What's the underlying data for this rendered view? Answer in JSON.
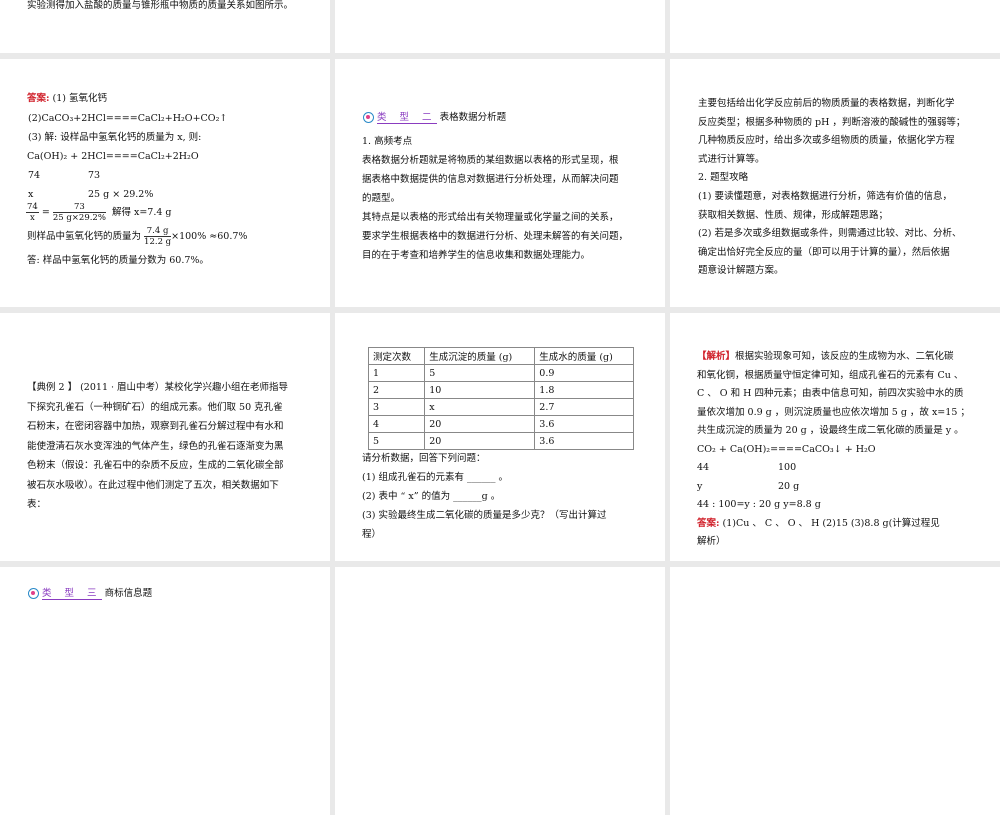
{
  "slide_top_left": {
    "text": "实验测得加入盐酸的质量与锥形瓶中物质的质量关系如图所示。"
  },
  "slide_answer1": {
    "label": "答案:",
    "l1": "(1) 氢氧化钙",
    "l2": "(2)CaCO₃+2HCl====CaCl₂+H₂O+CO₂↑",
    "l3": "(3) 解: 设样品中氢氧化钙的质量为 x, 则:",
    "l4": "Ca(OH)₂  +   2HCl====CaCl₂+2H₂O",
    "l5a": "74",
    "l5b": "73",
    "l6a": "x",
    "l6b": "25 g × 29.2%",
    "f1n": "74",
    "f1d": "x",
    "f2n": "73",
    "f2d": "25 g×29.2%",
    "solve": "解得 x=7.4 g",
    "l8": "则样品中氢氧化钙的质量为",
    "f3n": "7.4 g",
    "f3d": "12.2 g",
    "l8b": "×100% ≈60.7%",
    "l9": "答: 样品中氢氧化钙的质量分数为 60.7%。"
  },
  "slide_type2": {
    "badge": "类 型 二",
    "title": "表格数据分析题",
    "lines": [
      "1. 高频考点",
      "表格数据分析题就是将物质的某组数据以表格的形式呈现，根",
      "据表格中数据提供的信息对数据进行分析处理，从而解决问题",
      "的题型。",
      "其特点是以表格的形式给出有关物理量或化学量之间的关系，",
      "要求学生根据表格中的数据进行分析、处理未解答的有关问题，",
      "目的在于考查和培养学生的信息收集和数据处理能力。"
    ]
  },
  "slide_type2_cont": {
    "lines": [
      "主要包括给出化学反应前后的物质质量的表格数据，判断化学",
      "反应类型；根据多种物质的 pH ，判断溶液的酸碱性的强弱等；",
      "几种物质反应时，给出多次或多组物质的质量，依据化学方程",
      "式进行计算等。",
      "2. 题型攻略",
      "(1) 要读懂题意，对表格数据进行分析，筛选有价值的信息，",
      "获取相关数据、性质、规律，形成解题思路；",
      "(2) 若是多次或多组数据或条件，则需通过比较、对比、分析、",
      "确定出恰好完全反应的量（即可以用于计算的量），然后依据",
      "题意设计解题方案。"
    ]
  },
  "slide_example2": {
    "lines": [
      "【典例 2 】 (2011 · 眉山中考）某校化学兴趣小组在老师指导",
      "下探究孔雀石（一种铜矿石）的组成元素。他们取 50 克孔雀",
      "石粉末，在密闭容器中加热，观察到孔雀石分解过程中有水和",
      "能使澄清石灰水变浑浊的气体产生，绿色的孔雀石逐渐变为黑",
      "色粉末（假设：孔雀石中的杂质不反应，生成的二氧化碳全部",
      "被石灰水吸收）。在此过程中他们测定了五次，相关数据如下",
      "表："
    ]
  },
  "slide_table": {
    "headers": [
      "测定次数",
      "生成沉淀的质量 (g)",
      "生成水的质量 (g)"
    ],
    "rows": [
      [
        "1",
        "5",
        "0.9"
      ],
      [
        "2",
        "10",
        "1.8"
      ],
      [
        "3",
        "x",
        "2.7"
      ],
      [
        "4",
        "20",
        "3.6"
      ],
      [
        "5",
        "20",
        "3.6"
      ]
    ],
    "questions": [
      "请分析数据，回答下列问题：",
      "(1) 组成孔雀石的元素有 ______ 。",
      "(2) 表中 “ x” 的值为 ______g 。",
      "(3) 实验最终生成二氧化碳的质量是多少克？（写出计算过",
      "程）"
    ]
  },
  "slide_analysis": {
    "label": "【解析】",
    "l1": "根据实验现象可知，该反应的生成物为水、二氧化碳",
    "lines": [
      "和氧化铜，根据质量守恒定律可知，组成孔雀石的元素有 Cu 、",
      "C 、 O 和 H 四种元素；由表中信息可知，前四次实验中水的质",
      "量依次增加 0.9 g ，则沉淀质量也应依次增加 5 g ，故 x=15 ；",
      "共生成沉淀的质量为 20 g ，设最终生成二氧化碳的质量是 y 。",
      "CO₂ + Ca(OH)₂====CaCO₃↓ + H₂O"
    ],
    "r1a": "44",
    "r1b": "100",
    "r2a": "y",
    "r2b": "20 g",
    "ratio": "44 : 100=y : 20 g    y=8.8 g",
    "ans_label": "答案:",
    "ans": "(1)Cu 、 C 、 O 、 H    (2)15   (3)8.8 g(计算过程见",
    "ans2": "解析）"
  },
  "slide_type3": {
    "badge": "类 型 三",
    "title": "商标信息题"
  },
  "colors": {
    "accent_red": "#d0202a",
    "type_purple": "#8a3cc0"
  }
}
